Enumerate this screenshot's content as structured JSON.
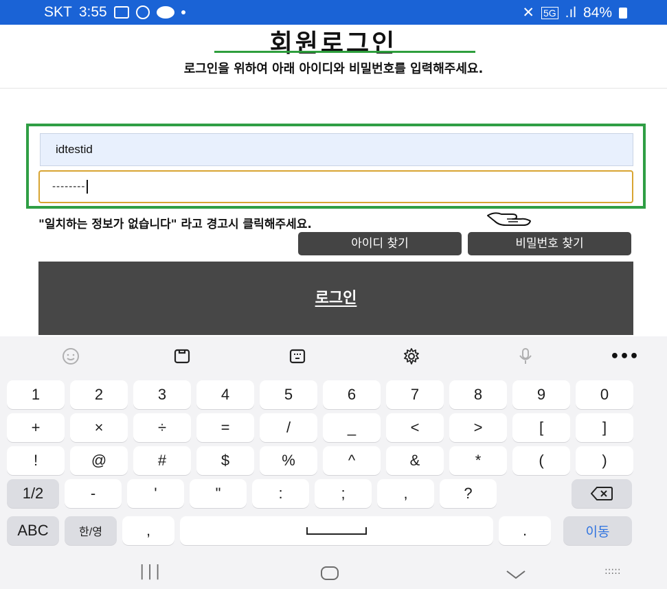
{
  "status_bar": {
    "carrier": "SKT",
    "time": "3:55",
    "network": "5G",
    "battery": "84%",
    "icons": [
      "image-icon",
      "instagram-icon",
      "kakaotalk-icon",
      "dot-icon",
      "mute-icon",
      "signal-icon",
      "battery-icon"
    ]
  },
  "header": {
    "title": "회원로그인",
    "subtitle": "로그인을 위하여 아래 아이디와 비밀번호를 입력해주세요."
  },
  "form": {
    "id_value": "idtestid",
    "password_value": "--------",
    "warning": "\"일치하는 정보가 없습니다\" 라고 경고시 클릭해주세요."
  },
  "buttons": {
    "find_id": "아이디 찾기",
    "find_password": "비밀번호 찾기",
    "login": "로그인"
  },
  "keyboard": {
    "toolbar_icons": [
      "emoji-icon",
      "clipboard-icon",
      "keyboard-mode-icon",
      "settings-icon",
      "mic-icon",
      "more-icon"
    ],
    "row1": [
      "1",
      "2",
      "3",
      "4",
      "5",
      "6",
      "7",
      "8",
      "9",
      "0"
    ],
    "row2": [
      "+",
      "×",
      "÷",
      "=",
      "/",
      "_",
      "<",
      ">",
      "[",
      "]"
    ],
    "row3": [
      "!",
      "@",
      "#",
      "$",
      "%",
      "^",
      "&",
      "*",
      "(",
      ")"
    ],
    "row4": [
      "1/2",
      "-",
      "'",
      "\"",
      ":",
      ";",
      ",",
      "?"
    ],
    "abc": "ABC",
    "lang": "한/영",
    "comma": ",",
    "period": ".",
    "go": "이동"
  },
  "colors": {
    "status_bar": "#1a63d6",
    "accent_green": "#2f9e44",
    "focus_border": "#d8a431",
    "button_dark": "#474747",
    "action_key": "#2f73e0"
  }
}
